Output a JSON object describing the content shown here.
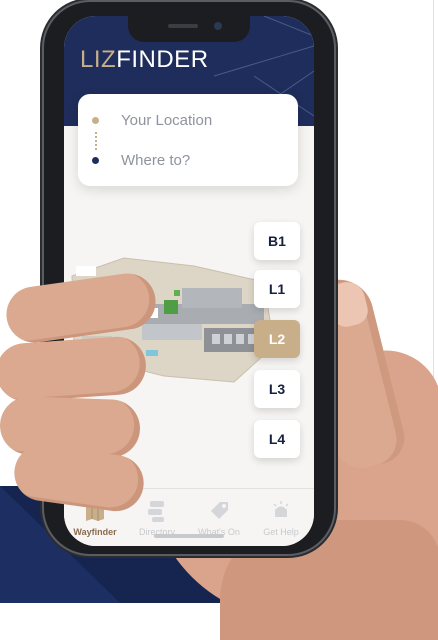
{
  "app": {
    "logo_part1": "LIZ",
    "logo_part2": "FINDER"
  },
  "search": {
    "from_placeholder": "Your Location",
    "to_placeholder": "Where to?"
  },
  "floors": [
    {
      "label": "B1",
      "active": false
    },
    {
      "label": "L1",
      "active": false
    },
    {
      "label": "L2",
      "active": true
    },
    {
      "label": "L3",
      "active": false
    },
    {
      "label": "L4",
      "active": false
    }
  ],
  "tabs": [
    {
      "label": "Wayfinder",
      "icon": "map-icon",
      "active": true
    },
    {
      "label": "Directory",
      "icon": "directory-icon",
      "active": false
    },
    {
      "label": "What's On",
      "icon": "tag-icon",
      "active": false
    },
    {
      "label": "Get Help",
      "icon": "bell-icon",
      "active": false
    }
  ],
  "colors": {
    "navy": "#1f2d5c",
    "tan": "#c9ae8a",
    "tab_active": "#8b6b4e"
  }
}
